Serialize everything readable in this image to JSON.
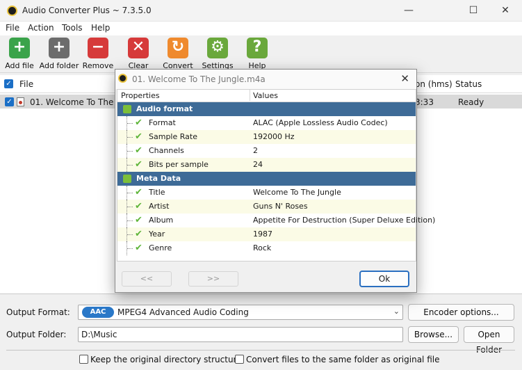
{
  "window": {
    "title": "Audio Converter Plus ~ 7.3.5.0",
    "minimize": "—",
    "maximize": "☐",
    "close": "✕"
  },
  "menu": [
    "File",
    "Action",
    "Tools",
    "Help"
  ],
  "toolbar": [
    {
      "label": "Add file",
      "icon": "plus-icon",
      "color": "#3aa34a",
      "glyph": "+"
    },
    {
      "label": "Add folder",
      "icon": "folder-add-icon",
      "color": "#6c6c6c",
      "glyph": "+"
    },
    {
      "label": "Remove",
      "icon": "minus-icon",
      "color": "#d63a3a",
      "glyph": "−"
    },
    {
      "label": "Clear",
      "icon": "clear-icon",
      "color": "#d63a3a",
      "glyph": "✕"
    },
    {
      "label": "Convert",
      "icon": "convert-icon",
      "color": "#ef8a2e",
      "glyph": "↻"
    },
    {
      "label": "Settings",
      "icon": "gear-icon",
      "color": "#6aa83c",
      "glyph": "⚙"
    },
    {
      "label": "Help",
      "icon": "help-icon",
      "color": "#6aa83c",
      "glyph": "?"
    }
  ],
  "list": {
    "columns": {
      "file": "File",
      "duration": "on (hms)",
      "status": "Status"
    },
    "rows": [
      {
        "file": "01. Welcome To The Jungle",
        "duration": "3:33",
        "status": "Ready",
        "checked": true
      }
    ]
  },
  "dialog": {
    "title": "01. Welcome To The Jungle.m4a",
    "close": "✕",
    "headers": {
      "properties": "Properties",
      "values": "Values"
    },
    "groups": [
      {
        "name": "Audio format",
        "rows": [
          {
            "name": "Format",
            "value": "ALAC (Apple Lossless Audio Codec)"
          },
          {
            "name": "Sample Rate",
            "value": "192000 Hz"
          },
          {
            "name": "Channels",
            "value": "2"
          },
          {
            "name": "Bits per sample",
            "value": "24"
          }
        ]
      },
      {
        "name": "Meta Data",
        "rows": [
          {
            "name": "Title",
            "value": "Welcome To The Jungle"
          },
          {
            "name": "Artist",
            "value": "Guns N' Roses"
          },
          {
            "name": "Album",
            "value": "Appetite For Destruction (Super Deluxe Edition)"
          },
          {
            "name": "Year",
            "value": "1987"
          },
          {
            "name": "Genre",
            "value": "Rock"
          }
        ]
      }
    ],
    "prev": "<<",
    "next": ">>",
    "ok": "Ok"
  },
  "output": {
    "format_label": "Output Format:",
    "format_badge": "AAC",
    "format_value": "MPEG4 Advanced Audio Coding",
    "encoder_button": "Encoder options...",
    "folder_label": "Output Folder:",
    "folder_value": "D:\\Music",
    "browse_button": "Browse...",
    "open_folder_button": "Open Folder",
    "keep_structure": "Keep the original directory structure",
    "same_folder": "Convert files to the same folder as original file"
  }
}
